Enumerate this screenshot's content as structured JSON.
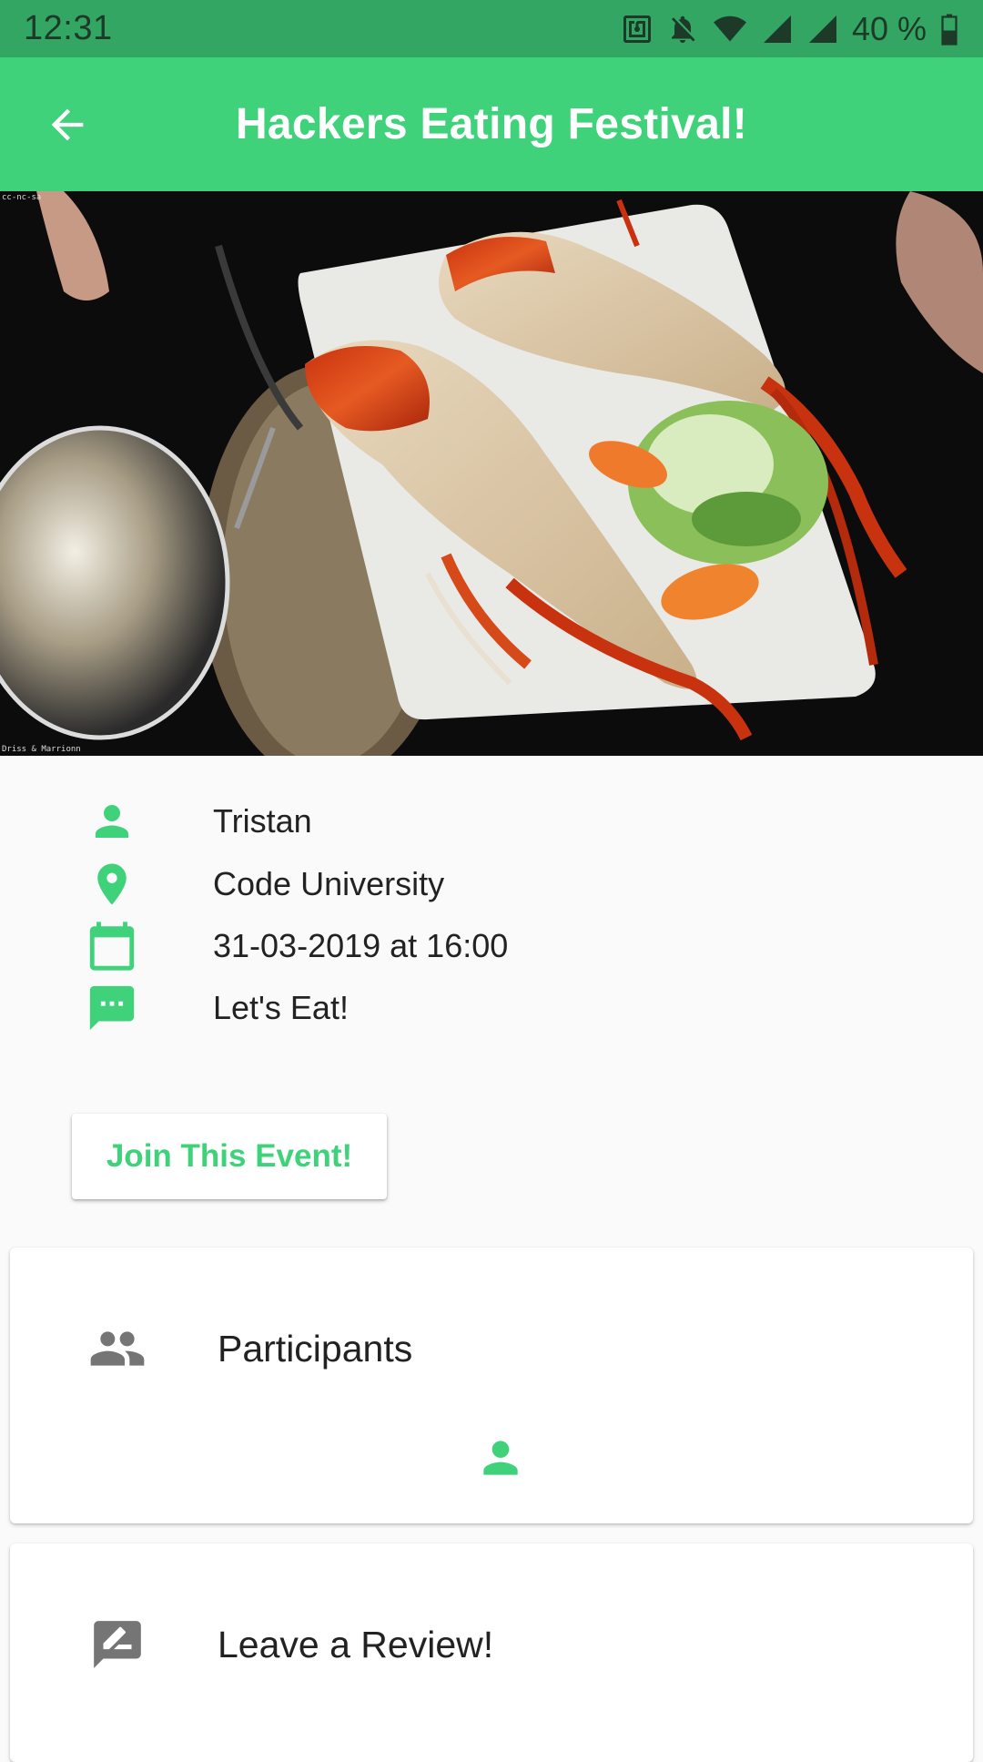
{
  "status_bar": {
    "time": "12:31",
    "battery": "40 %",
    "icons": [
      "nfc-icon",
      "bell-off-icon",
      "wifi-icon",
      "signal-icon",
      "signal-icon",
      "battery-icon"
    ]
  },
  "app_bar": {
    "title": "Hackers Eating Festival!",
    "back_icon": "arrow-back-icon"
  },
  "hero": {
    "credit_top": "cc-nc-sa",
    "credit_bottom": "Driss & Marrionn"
  },
  "details": {
    "host": "Tristan",
    "location": "Code University",
    "datetime": "31-03-2019 at 16:00",
    "description": "Let's Eat!"
  },
  "join_button": "Join This Event!",
  "participants_card": {
    "title": "Participants",
    "icon": "people-icon"
  },
  "review_card": {
    "title": "Leave a Review!",
    "icon": "rate-review-icon"
  },
  "colors": {
    "accent": "#3fd27b",
    "status_bar": "#34a663",
    "icon_gray": "#757575"
  }
}
